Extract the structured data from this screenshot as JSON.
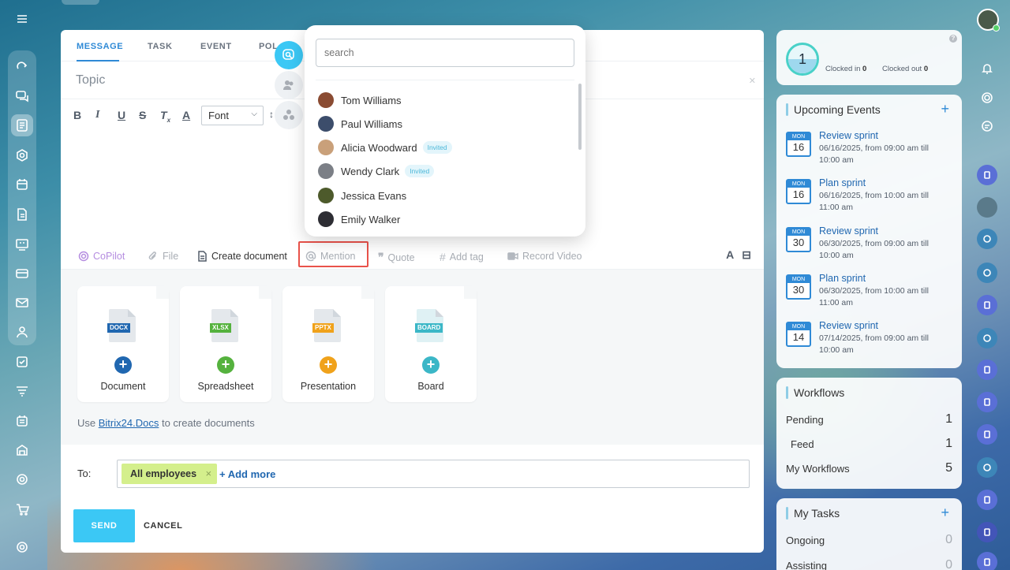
{
  "tabs": [
    "MESSAGE",
    "TASK",
    "EVENT",
    "POL"
  ],
  "composer": {
    "topic_placeholder": "Topic",
    "font_select": "Font",
    "actions": {
      "copilot": "CoPilot",
      "file": "File",
      "create_document": "Create document",
      "mention": "Mention",
      "quote": "Quote",
      "add_tag": "Add tag",
      "record_video": "Record Video"
    },
    "docs": [
      {
        "label": "Document",
        "tag": "DOCX",
        "tag_color": "#2067b0",
        "plus_color": "#2067b0"
      },
      {
        "label": "Spreadsheet",
        "tag": "XLSX",
        "tag_color": "#55b23e",
        "plus_color": "#55b23e"
      },
      {
        "label": "Presentation",
        "tag": "PPTX",
        "tag_color": "#f0a21b",
        "plus_color": "#f0a21b"
      },
      {
        "label": "Board",
        "tag": "BOARD",
        "tag_color": "#3bb7c7",
        "plus_color": "#3bb7c7"
      }
    ],
    "docs_note_prefix": "Use",
    "docs_note_link": "Bitrix24.Docs",
    "docs_note_suffix": "to create documents",
    "to_label": "To:",
    "recipient_chip": "All employees",
    "add_more": "+ Add more",
    "send": "SEND",
    "cancel": "CANCEL"
  },
  "mention_dropdown": {
    "search_placeholder": "search",
    "people": [
      {
        "name": "Tom Williams",
        "invited": false,
        "avatar_color": "#8a4b32"
      },
      {
        "name": "Paul Williams",
        "invited": false,
        "avatar_color": "#3c4d6b"
      },
      {
        "name": "Alicia Woodward",
        "invited": true,
        "avatar_color": "#c9a07a"
      },
      {
        "name": "Wendy Clark",
        "invited": true,
        "avatar_color": "#7b7f86"
      },
      {
        "name": "Jessica Evans",
        "invited": false,
        "avatar_color": "#4d5a2b"
      },
      {
        "name": "Emily Walker",
        "invited": false,
        "avatar_color": "#2d2d33"
      }
    ],
    "invited_badge": "Invited"
  },
  "timeman": {
    "count": "1",
    "clocked_in_label": "Clocked in",
    "clocked_in_value": "0",
    "clocked_out_label": "Clocked out",
    "clocked_out_value": "0"
  },
  "upcoming_events": {
    "title": "Upcoming Events",
    "events": [
      {
        "month": "MON",
        "day": "16",
        "title": "Review sprint",
        "time": "06/16/2025, from 09:00 am till 10:00 am"
      },
      {
        "month": "MON",
        "day": "16",
        "title": "Plan sprint",
        "time": "06/16/2025, from 10:00 am till 11:00 am"
      },
      {
        "month": "MON",
        "day": "30",
        "title": "Review sprint",
        "time": "06/30/2025, from 09:00 am till 10:00 am"
      },
      {
        "month": "MON",
        "day": "30",
        "title": "Plan sprint",
        "time": "06/30/2025, from 10:00 am till 11:00 am"
      },
      {
        "month": "MON",
        "day": "14",
        "title": "Review sprint",
        "time": "07/14/2025, from 09:00 am till 10:00 am"
      }
    ]
  },
  "workflows": {
    "title": "Workflows",
    "rows": [
      {
        "label": "Pending",
        "value": "1"
      },
      {
        "label": "Feed",
        "value": "1"
      },
      {
        "label": "My Workflows",
        "value": "5"
      }
    ]
  },
  "my_tasks": {
    "title": "My Tasks",
    "rows": [
      {
        "label": "Ongoing",
        "value": "0"
      },
      {
        "label": "Assisting",
        "value": "0"
      }
    ]
  },
  "colors": {
    "accent": "#2f8ad6",
    "send": "#3bc8f5",
    "chip": "#d4ef8c",
    "highlight": "#e9524a"
  },
  "icons": {
    "left_rail": [
      "menu-icon",
      "sites-icon",
      "chat-icon",
      "feed-icon",
      "hexagon-icon",
      "calendar-icon",
      "docs-icon",
      "reservation-icon",
      "card-icon",
      "mail-icon",
      "team-icon",
      "tasks-icon",
      "filter-icon",
      "schedule-icon",
      "store-icon",
      "target-icon",
      "cart-icon",
      "settings-icon"
    ],
    "right_rail": [
      "profile-avatar",
      "bell-icon",
      "copilot-icon",
      "support-chat-icon",
      "notebook-icon",
      "user-avatar",
      "copilot-icon",
      "copilot-icon",
      "notebook-icon",
      "copilot-icon",
      "notebook-icon",
      "notebook-icon",
      "copilot-icon",
      "notebook-icon",
      "notebook-icon",
      "notebook-icon"
    ]
  }
}
